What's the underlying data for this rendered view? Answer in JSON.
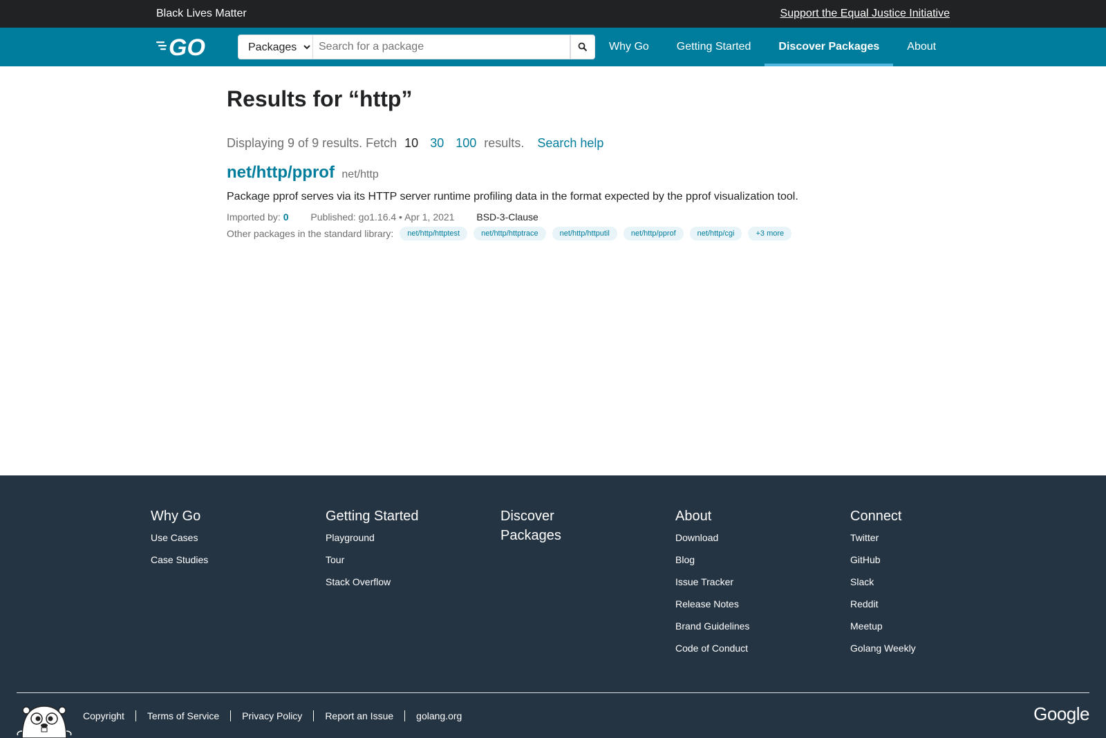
{
  "banner": {
    "left_text": "Black Lives Matter",
    "right_link": "Support the Equal Justice Initiative"
  },
  "header": {
    "logo_text": "GO",
    "search": {
      "scope_selected": "Packages",
      "placeholder": "Search for a package"
    },
    "nav": [
      {
        "label": "Why Go",
        "active": false
      },
      {
        "label": "Getting Started",
        "active": false
      },
      {
        "label": "Discover Packages",
        "active": true
      },
      {
        "label": "About",
        "active": false
      }
    ]
  },
  "main": {
    "title": "Results for “http”",
    "summary": {
      "prefix": "Displaying 9 of 9 results. Fetch",
      "current": "10",
      "option_30": "30",
      "option_100": "100",
      "suffix": "results.",
      "help": "Search help"
    },
    "result": {
      "name": "net/http/pprof",
      "path": "net/http",
      "synopsis": "Package pprof serves via its HTTP server runtime profiling data in the format expected by the pprof visualization tool.",
      "imported_by_label": "Imported by:",
      "imported_by_count": "0",
      "published": "Published: go1.16.4 • Apr 1, 2021",
      "license": "BSD-3-Clause",
      "others_label": "Other packages in the standard library:",
      "others": [
        "net/http/httptest",
        "net/http/httptrace",
        "net/http/httputil",
        "net/http/pprof",
        "net/http/cgi",
        "+3 more"
      ]
    }
  },
  "footer": {
    "columns": [
      {
        "title": "Why Go",
        "items": [
          "Use Cases",
          "Case Studies"
        ]
      },
      {
        "title": "Getting Started",
        "items": [
          "Playground",
          "Tour",
          "Stack Overflow"
        ]
      },
      {
        "title": "Discover Packages",
        "items": []
      },
      {
        "title": "About",
        "items": [
          "Download",
          "Blog",
          "Issue Tracker",
          "Release Notes",
          "Brand Guidelines",
          "Code of Conduct"
        ]
      },
      {
        "title": "Connect",
        "items": [
          "Twitter",
          "GitHub",
          "Slack",
          "Reddit",
          "Meetup",
          "Golang Weekly"
        ]
      }
    ],
    "links": [
      "Copyright",
      "Terms of Service",
      "Privacy Policy",
      "Report an Issue",
      "golang.org"
    ],
    "google": "Google",
    "gopher_icon": "gopher-mascot-icon"
  },
  "colors": {
    "banner_bg": "#202224",
    "header_bg": "#007d9c",
    "link": "#007d9c",
    "footer_bg": "#253443",
    "nav_active_underline": "#50b7e0"
  }
}
